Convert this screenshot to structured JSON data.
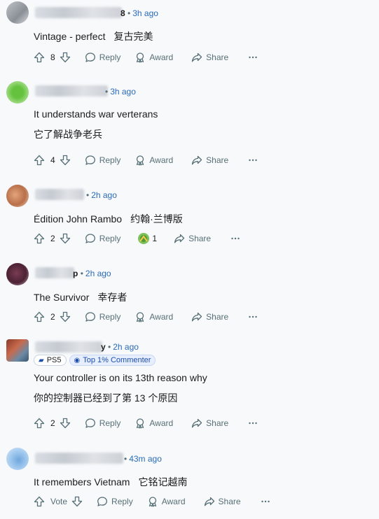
{
  "colors": {
    "accent": "#2a6bb8",
    "text": "#1c1c1c",
    "muted": "#576f76",
    "background": "#f7f9fb"
  },
  "comments": [
    {
      "meta_suffix": "8",
      "time": "3h ago",
      "text": "Vintage - perfect",
      "translation": "复古完美",
      "votes": "8",
      "reply": "Reply",
      "award": "Award",
      "share": "Share"
    },
    {
      "meta_suffix": "",
      "time": "3h ago",
      "text": "It understands war verterans",
      "translation": "它了解战争老兵",
      "votes": "4",
      "reply": "Reply",
      "award": "Award",
      "share": "Share"
    },
    {
      "meta_suffix": "",
      "time": "2h ago",
      "text": "Édition John Rambo",
      "translation": "约翰·兰博版",
      "votes": "2",
      "reply": "Reply",
      "award_count": "1",
      "share": "Share"
    },
    {
      "meta_suffix": "p",
      "time": "2h ago",
      "text": "The Survivor",
      "translation": "幸存者",
      "votes": "2",
      "reply": "Reply",
      "award": "Award",
      "share": "Share"
    },
    {
      "meta_suffix": "y",
      "time": "2h ago",
      "flair_platform": "PS5",
      "flair_badge": "Top 1% Commenter",
      "text": "Your controller is on its 13th reason why",
      "translation": "你的控制器已经到了第 13 个原因",
      "votes": "2",
      "reply": "Reply",
      "award": "Award",
      "share": "Share"
    },
    {
      "meta_suffix": "",
      "time": "43m ago",
      "text": "It remembers Vietnam",
      "translation": "它铭记越南",
      "votes": "Vote",
      "reply": "Reply",
      "award": "Award",
      "share": "Share"
    }
  ]
}
